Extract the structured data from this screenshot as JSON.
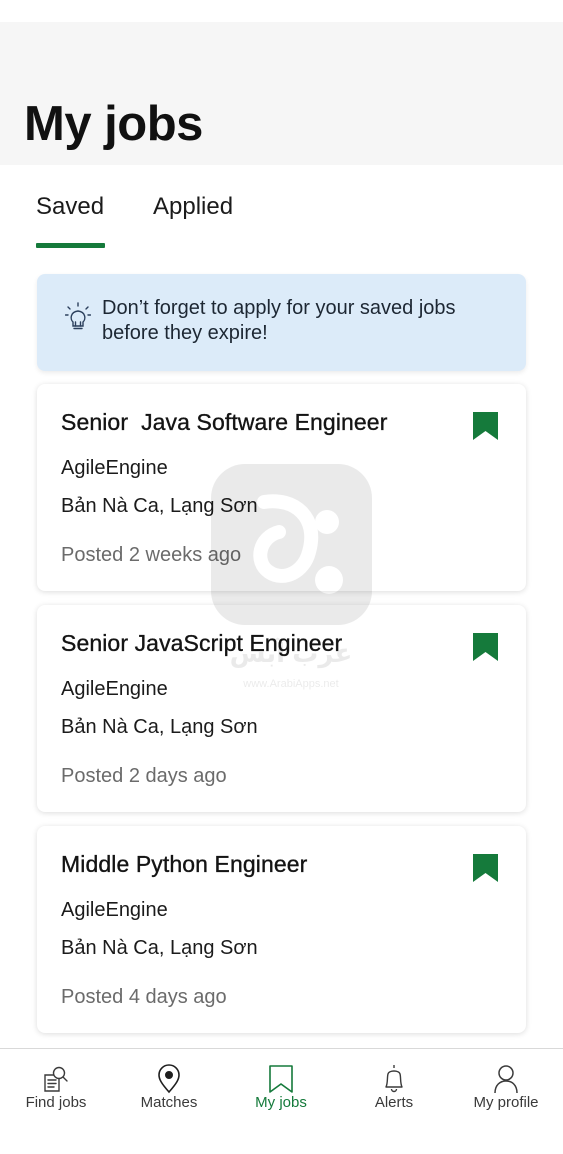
{
  "header": {
    "title": "My jobs"
  },
  "tabs": [
    {
      "label": "Saved",
      "active": true
    },
    {
      "label": "Applied",
      "active": false
    }
  ],
  "tip": {
    "icon": "lightbulb-icon",
    "text": "Don’t forget to apply for your saved jobs before they expire!"
  },
  "jobs": [
    {
      "title": "Senior  Java Software Engineer",
      "company": "AgileEngine",
      "location": "Bản Nà Ca, Lạng Sơn",
      "posted": "Posted 2 weeks ago",
      "saved": true
    },
    {
      "title": "Senior JavaScript Engineer",
      "company": "AgileEngine",
      "location": "Bản Nà Ca, Lạng Sơn",
      "posted": "Posted 2 days ago",
      "saved": true
    },
    {
      "title": "Middle Python Engineer",
      "company": "AgileEngine",
      "location": "Bản Nà Ca, Lạng Sơn",
      "posted": "Posted 4 days ago",
      "saved": true
    }
  ],
  "watermark": {
    "text": "عرب آبس",
    "url": "www.ArabiApps.net"
  },
  "bottom_nav": [
    {
      "label": "Find jobs",
      "icon": "find-jobs-icon",
      "active": false
    },
    {
      "label": "Matches",
      "icon": "map-pin-icon",
      "active": false
    },
    {
      "label": "My jobs",
      "icon": "bookmark-icon",
      "active": true
    },
    {
      "label": "Alerts",
      "icon": "bell-icon",
      "active": false
    },
    {
      "label": "My profile",
      "icon": "person-icon",
      "active": false
    }
  ],
  "colors": {
    "accent_green": "#157a3b",
    "tip_background": "#dcebf9",
    "header_background": "#f6f6f6",
    "muted_text": "#6b6b6b"
  }
}
